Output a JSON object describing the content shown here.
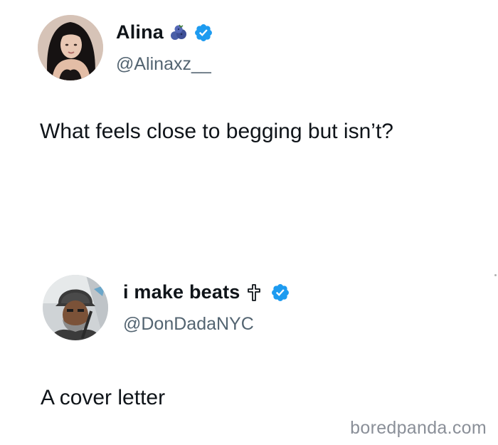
{
  "tweets": [
    {
      "display_name": "Alina",
      "handle": "@Alinaxz__",
      "text": "What feels close to begging but isn’t?",
      "emoji_icon": "blueberries-icon",
      "verified": true
    },
    {
      "display_name": "i make beats",
      "handle": "@DonDadaNYC",
      "text": "A cover letter",
      "emoji_icon": "latin-cross-icon",
      "verified": true
    }
  ],
  "watermark": "boredpanda.com",
  "colors": {
    "verified_badge": "#1d9bf0",
    "handle": "#536471",
    "text": "#0f1419",
    "watermark": "#8a8f98"
  }
}
